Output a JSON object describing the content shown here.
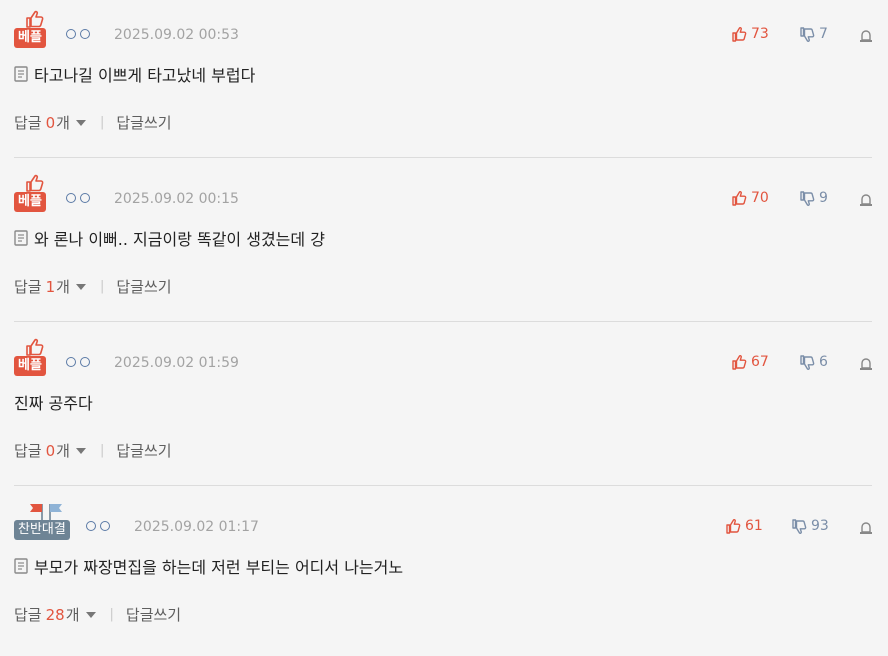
{
  "comments": [
    {
      "badge": "베플",
      "badge_type": "best",
      "date": "2025.09.02 00:53",
      "up": "73",
      "down": "7",
      "has_memo_icon": true,
      "text": "타고나길 이쁘게 타고났네 부럽다",
      "reply_label": "답글",
      "reply_count": "0",
      "reply_unit": "개",
      "write_label": "답글쓰기"
    },
    {
      "badge": "베플",
      "badge_type": "best",
      "date": "2025.09.02 00:15",
      "up": "70",
      "down": "9",
      "has_memo_icon": true,
      "text": "와 론나 이뻐.. 지금이랑 똑같이 생겼는데 걍",
      "reply_label": "답글",
      "reply_count": "1",
      "reply_unit": "개",
      "write_label": "답글쓰기"
    },
    {
      "badge": "베플",
      "badge_type": "best",
      "date": "2025.09.02 01:59",
      "up": "67",
      "down": "6",
      "has_memo_icon": false,
      "text": "진짜 공주다",
      "reply_label": "답글",
      "reply_count": "0",
      "reply_unit": "개",
      "write_label": "답글쓰기"
    },
    {
      "badge": "찬반대결",
      "badge_type": "vs",
      "date": "2025.09.02 01:17",
      "up": "61",
      "down": "93",
      "has_memo_icon": true,
      "text": "부모가 짜장면집을 하는데 저런 부티는 어디서 나는거노",
      "reply_label": "답글",
      "reply_count": "28",
      "reply_unit": "개",
      "write_label": "답글쓰기"
    }
  ],
  "colors": {
    "accent_red": "#e2553f",
    "vs_badge": "#6e8495",
    "down_blue": "#7b8ea8",
    "date_gray": "#a3a3a3"
  },
  "icons": {
    "badge_top": "thumbs-up-outline-icon",
    "vs_top": "flags-icon",
    "user": "double-circle-icon",
    "up": "thumbs-up-icon",
    "down": "thumbs-down-icon",
    "report": "report-siren-icon",
    "memo": "memo-image-icon",
    "caret": "caret-down-icon"
  }
}
